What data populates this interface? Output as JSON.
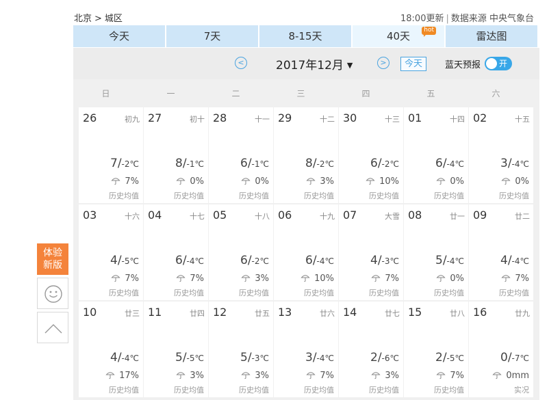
{
  "header": {
    "breadcrumb": [
      "北京",
      "城区"
    ],
    "update_time": "18:00更新",
    "source": "数据来源 中央气象台"
  },
  "tabs": [
    {
      "label": "今天",
      "width": 134
    },
    {
      "label": "7天",
      "width": 134
    },
    {
      "label": "8-15天",
      "width": 134
    },
    {
      "label": "40天",
      "width": 134,
      "active": true,
      "badge": "hot"
    },
    {
      "label": "雷达图",
      "width": 134
    }
  ],
  "calendar": {
    "month_title": "2017年12月",
    "prev_icon": "chevron-left-icon",
    "next_icon": "chevron-right-icon",
    "today_label": "今天",
    "bluesky_label": "蓝天预报",
    "bluesky_toggle": "开",
    "weekdays": [
      "日",
      "一",
      "二",
      "三",
      "四",
      "五",
      "六"
    ],
    "weeks": [
      [
        {
          "day": "26",
          "lunar": "初九",
          "high": "7",
          "low": "-2℃",
          "rain": "7%",
          "note": "历史均值"
        },
        {
          "day": "27",
          "lunar": "初十",
          "high": "8",
          "low": "-1℃",
          "rain": "0%",
          "note": "历史均值"
        },
        {
          "day": "28",
          "lunar": "十一",
          "high": "6",
          "low": "-1℃",
          "rain": "0%",
          "note": "历史均值"
        },
        {
          "day": "29",
          "lunar": "十二",
          "high": "8",
          "low": "-2℃",
          "rain": "3%",
          "note": "历史均值"
        },
        {
          "day": "30",
          "lunar": "十三",
          "high": "6",
          "low": "-2℃",
          "rain": "10%",
          "note": "历史均值"
        },
        {
          "day": "01",
          "lunar": "十四",
          "high": "6",
          "low": "-4℃",
          "rain": "0%",
          "note": "历史均值"
        },
        {
          "day": "02",
          "lunar": "十五",
          "high": "3",
          "low": "-4℃",
          "rain": "0%",
          "note": "历史均值"
        }
      ],
      [
        {
          "day": "03",
          "lunar": "十六",
          "high": "4",
          "low": "-5℃",
          "rain": "7%",
          "note": "历史均值"
        },
        {
          "day": "04",
          "lunar": "十七",
          "high": "6",
          "low": "-4℃",
          "rain": "7%",
          "note": "历史均值"
        },
        {
          "day": "05",
          "lunar": "十八",
          "high": "6",
          "low": "-2℃",
          "rain": "3%",
          "note": "历史均值"
        },
        {
          "day": "06",
          "lunar": "十九",
          "high": "6",
          "low": "-4℃",
          "rain": "10%",
          "note": "历史均值"
        },
        {
          "day": "07",
          "lunar": "大雪",
          "high": "4",
          "low": "-3℃",
          "rain": "7%",
          "note": "历史均值"
        },
        {
          "day": "08",
          "lunar": "廿一",
          "high": "5",
          "low": "-4℃",
          "rain": "0%",
          "note": "历史均值"
        },
        {
          "day": "09",
          "lunar": "廿二",
          "high": "4",
          "low": "-4℃",
          "rain": "7%",
          "note": "历史均值"
        }
      ],
      [
        {
          "day": "10",
          "lunar": "廿三",
          "high": "4",
          "low": "-4℃",
          "rain": "17%",
          "note": "历史均值"
        },
        {
          "day": "11",
          "lunar": "廿四",
          "high": "5",
          "low": "-5℃",
          "rain": "3%",
          "note": "历史均值"
        },
        {
          "day": "12",
          "lunar": "廿五",
          "high": "5",
          "low": "-3℃",
          "rain": "3%",
          "note": "历史均值"
        },
        {
          "day": "13",
          "lunar": "廿六",
          "high": "3",
          "low": "-4℃",
          "rain": "7%",
          "note": "历史均值"
        },
        {
          "day": "14",
          "lunar": "廿七",
          "high": "2",
          "low": "-6℃",
          "rain": "3%",
          "note": "历史均值"
        },
        {
          "day": "15",
          "lunar": "廿八",
          "high": "2",
          "low": "-5℃",
          "rain": "7%",
          "note": "历史均值"
        },
        {
          "day": "16",
          "lunar": "廿九",
          "high": "0",
          "low": "-7℃",
          "rain": "0mm",
          "note": "实况"
        }
      ]
    ]
  },
  "sidebar": {
    "experience_label": "体验新版",
    "feedback_icon": "smiley-icon",
    "top_icon": "chevron-up-icon"
  },
  "colors": {
    "tab_bg": "#cfe6f8",
    "tab_active_bg": "#eaf6fe",
    "accent_blue": "#4aa3df",
    "orange": "#f4833b"
  }
}
